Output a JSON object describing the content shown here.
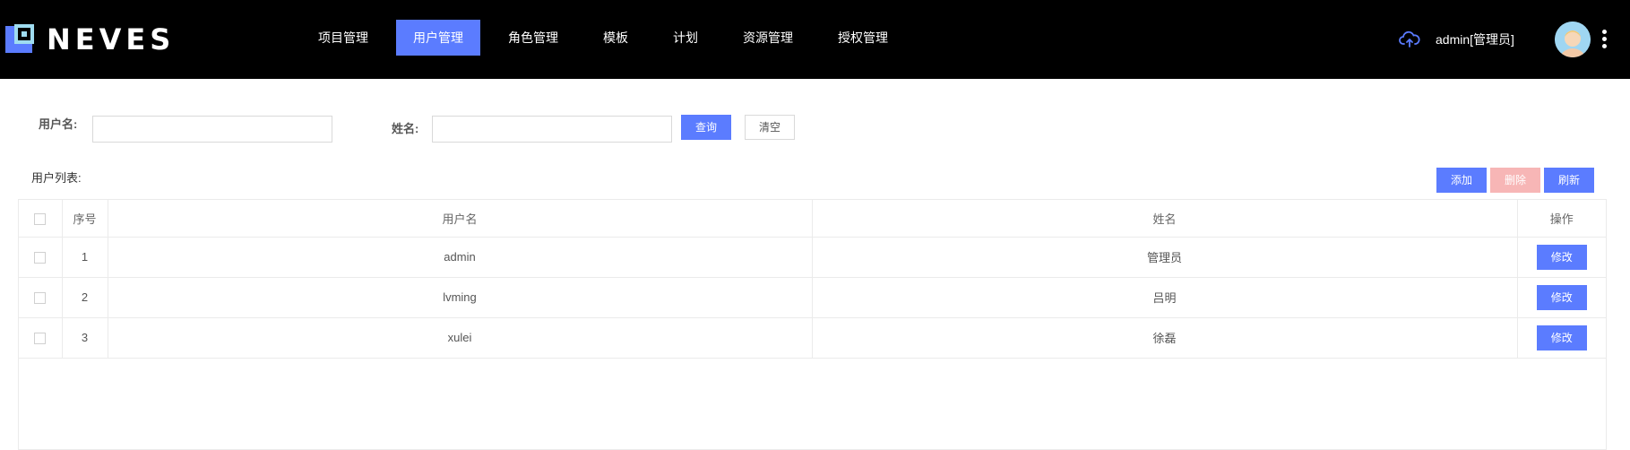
{
  "header": {
    "logo_text": "NEVES",
    "nav": [
      {
        "label": "项目管理",
        "active": false
      },
      {
        "label": "用户管理",
        "active": true
      },
      {
        "label": "角色管理",
        "active": false
      },
      {
        "label": "模板",
        "active": false
      },
      {
        "label": "计划",
        "active": false
      },
      {
        "label": "资源管理",
        "active": false
      },
      {
        "label": "授权管理",
        "active": false
      }
    ],
    "user_label": "admin[管理员]"
  },
  "search": {
    "username_label": "用户名:",
    "username_value": "",
    "name_label": "姓名:",
    "name_value": "",
    "query_label": "查询",
    "clear_label": "清空"
  },
  "list": {
    "title": "用户列表:",
    "add_label": "添加",
    "delete_label": "删除",
    "refresh_label": "刷新"
  },
  "table": {
    "columns": [
      "",
      "序号",
      "用户名",
      "姓名",
      "操作"
    ],
    "rows": [
      {
        "index": "1",
        "username": "admin",
        "name": "管理员",
        "action": "修改"
      },
      {
        "index": "2",
        "username": "lvming",
        "name": "吕明",
        "action": "修改"
      },
      {
        "index": "3",
        "username": "xulei",
        "name": "徐磊",
        "action": "修改"
      }
    ]
  },
  "colors": {
    "accent": "#5b7cff",
    "header_bg": "#000000",
    "danger_disabled": "#f7b6b6"
  }
}
